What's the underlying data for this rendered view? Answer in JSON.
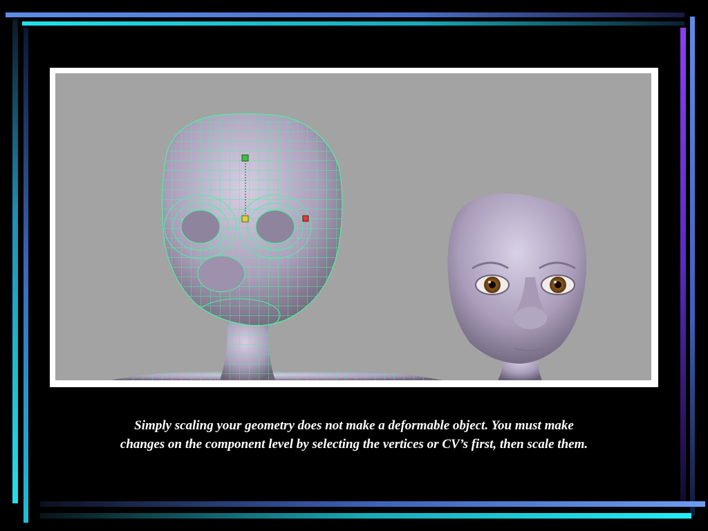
{
  "slide": {
    "caption_lines": [
      "Simply scaling your geometry does not make a deformable object. You must make",
      "changes on the component level by selecting the vertices or CV’s first, then scale them."
    ]
  },
  "figure": {
    "panels": [
      {
        "name": "wireframe-head",
        "description_icon": "mesh-head-icon"
      },
      {
        "name": "rendered-head",
        "description_icon": "shaded-head-icon"
      }
    ]
  },
  "colors": {
    "background": "#000000",
    "viewport": "#a3a3a3",
    "mesh": "#4df0a0",
    "skin": "#b4a8c4",
    "frame": "#ffffff",
    "caption": "#ffffff"
  }
}
